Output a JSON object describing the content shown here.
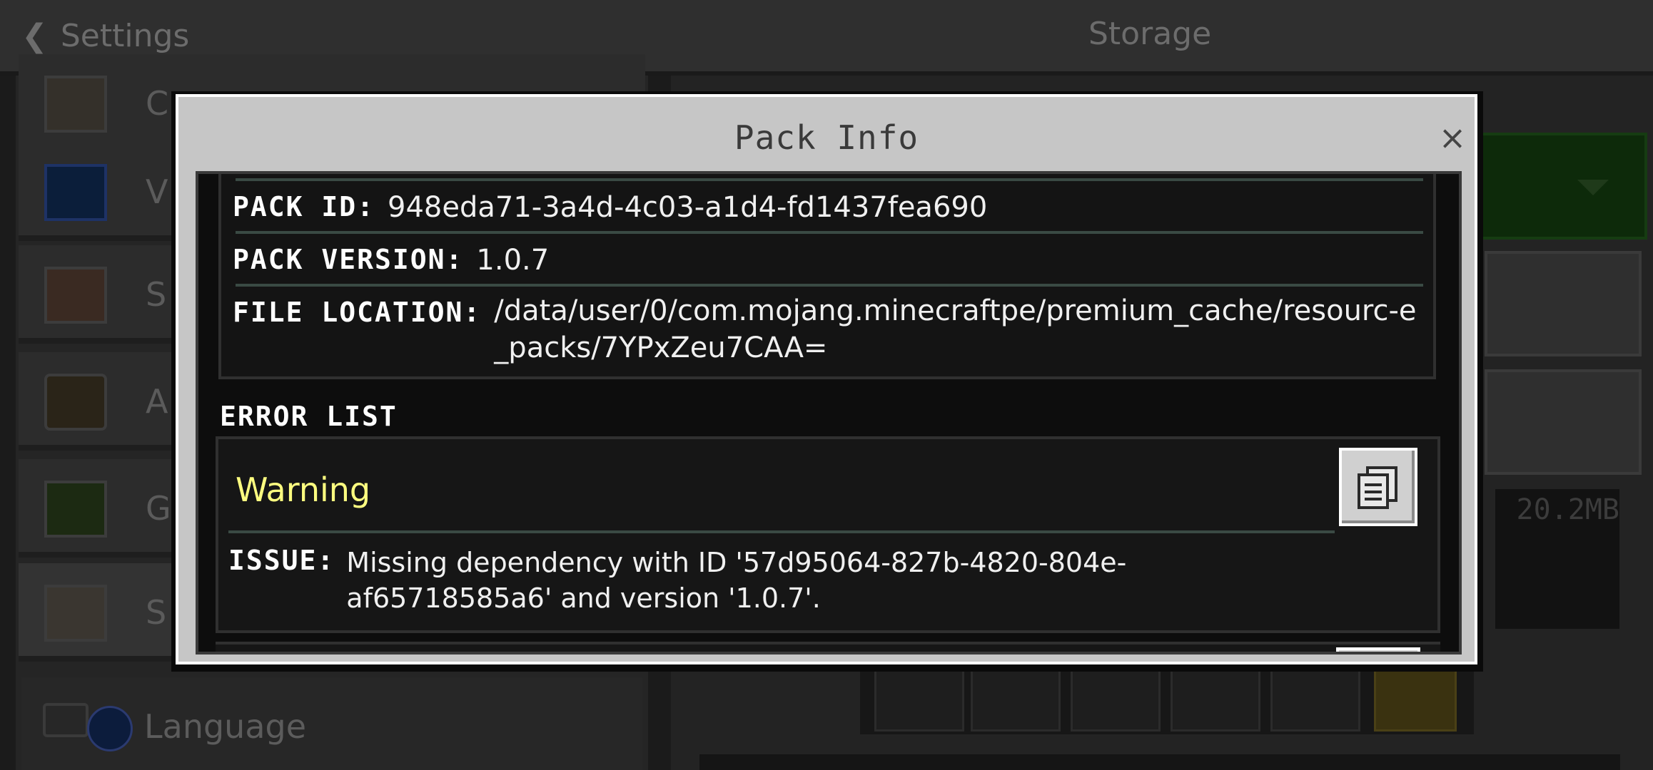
{
  "header": {
    "back_label": "Settings",
    "title": "Storage"
  },
  "sidebar": {
    "items": [
      {
        "label": "Creator",
        "icon": "creator-icon"
      },
      {
        "label": "V",
        "icon": "video-icon"
      },
      {
        "label": "S",
        "icon": "calendar-icon"
      },
      {
        "label": "A",
        "icon": "speaker-icon"
      },
      {
        "label": "G",
        "icon": "grass-block-icon"
      },
      {
        "label": "S",
        "icon": "folder-icon"
      }
    ],
    "language_label": "Language"
  },
  "right_panel": {
    "size_text": "20.2MB"
  },
  "modal": {
    "title": "Pack Info",
    "close_symbol": "×",
    "pack_id_key": "PACK ID:",
    "pack_id": "948eda71-3a4d-4c03-a1d4-fd1437fea690",
    "pack_version_key": "PACK VERSION:",
    "pack_version": "1.0.7",
    "file_location_key": "FILE LOCATION:",
    "file_location": "/data/user/0/com.mojang.minecraftpe/premium_cache/resourc-e_packs/7YPxZeu7CAA=",
    "error_list_title": "ERROR LIST",
    "errors": [
      {
        "level": "Warning",
        "issue_key": "ISSUE:",
        "issue": "Missing dependency with ID '57d95064-827b-4820-804e-af65718585a6' and version '1.0.7'."
      }
    ]
  },
  "colors": {
    "warning": "#ffff80",
    "modal_frame": "#c6c6c6",
    "content_bg": "#0d0d0d"
  }
}
